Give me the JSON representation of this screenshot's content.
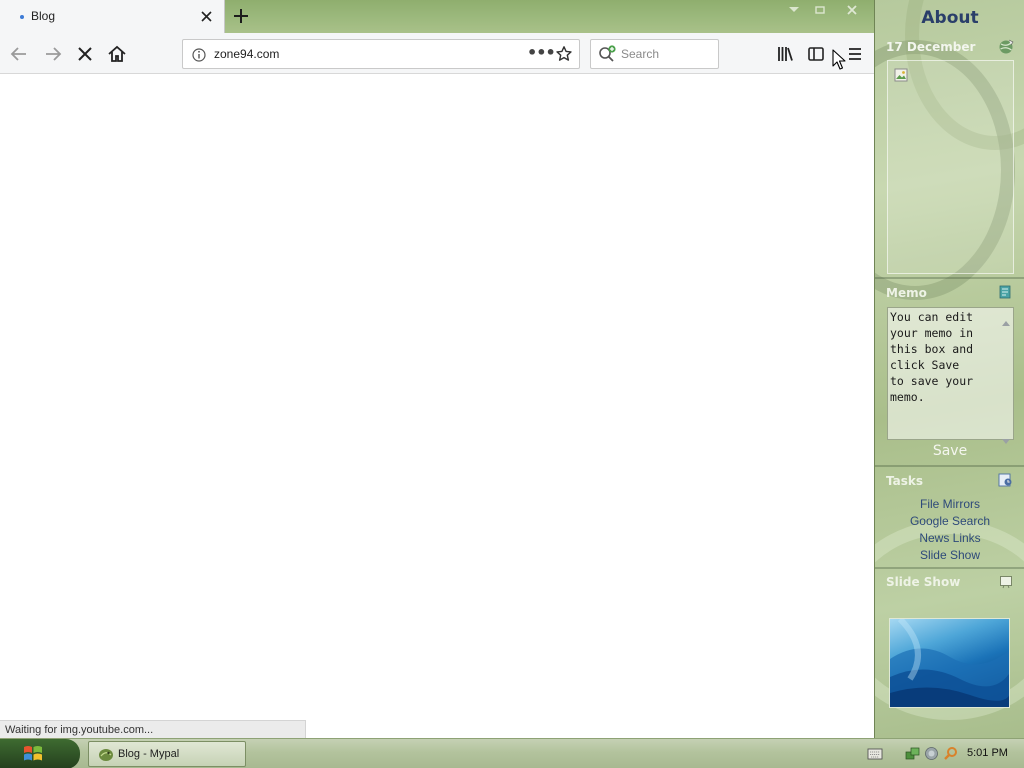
{
  "browser": {
    "tab": {
      "title": "Blog"
    },
    "url": "zone94.com",
    "url_more": "•••",
    "search_placeholder": "Search",
    "status_text": "Waiting for img.youtube.com..."
  },
  "sidebar": {
    "about_title": "About",
    "date": "17 December",
    "memo": {
      "label": "Memo",
      "text": "You can edit\nyour memo in\nthis box and\nclick Save\nto save your\nmemo.",
      "save_label": "Save"
    },
    "tasks": {
      "label": "Tasks",
      "items": [
        {
          "label": "File Mirrors"
        },
        {
          "label": "Google Search"
        },
        {
          "label": "News Links"
        },
        {
          "label": "Slide Show"
        }
      ]
    },
    "slideshow": {
      "label": "Slide Show"
    }
  },
  "taskbar": {
    "item_label": "Blog - Mypal",
    "clock": "5:01 PM"
  },
  "colors": {
    "sidebar_title": "#2a3e6a",
    "task_link": "#2e4a7a",
    "tab_dot": "#3d7bd6"
  }
}
